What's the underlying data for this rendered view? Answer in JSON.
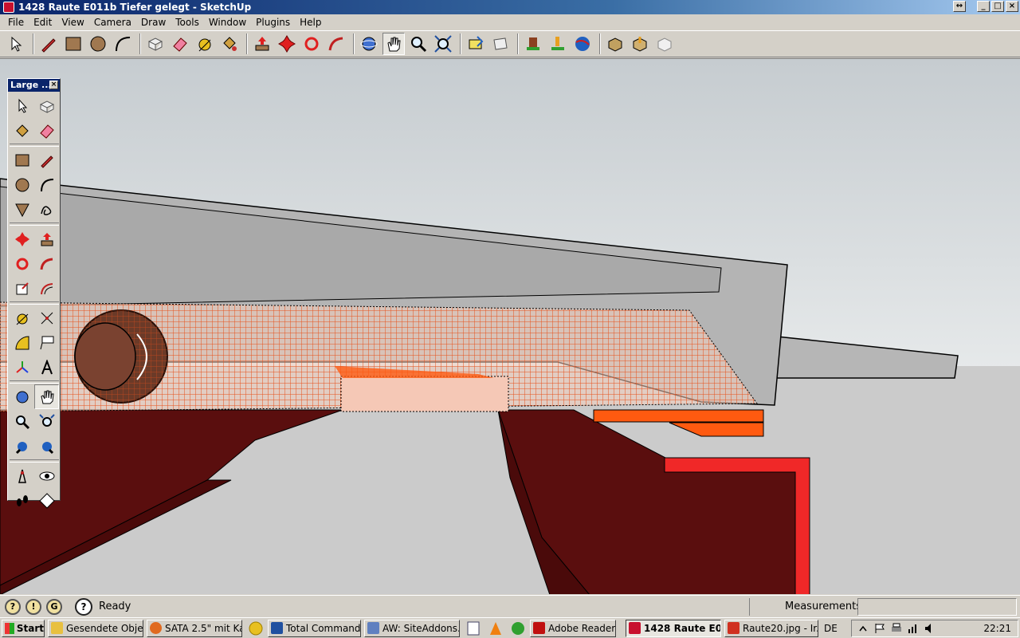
{
  "window": {
    "title": "1428 Raute E011b Tiefer gelegt - SketchUp",
    "buttons": {
      "restore_alt": "↔",
      "minimize": "_",
      "maximize": "□",
      "close": "×"
    }
  },
  "menu": [
    "File",
    "Edit",
    "View",
    "Camera",
    "Draw",
    "Tools",
    "Window",
    "Plugins",
    "Help"
  ],
  "toolbar": {
    "tools": [
      "select-icon",
      "pencil-icon",
      "rectangle-icon",
      "circle-icon",
      "arc-icon",
      "make-component-icon",
      "eraser-icon",
      "tape-measure-icon",
      "paint-bucket-icon",
      "push-pull-icon",
      "move-icon",
      "rotate-icon",
      "follow-me-icon",
      "orbit-icon",
      "pan-icon",
      "zoom-icon",
      "zoom-extents-icon",
      "previous-view-icon",
      "next-view-icon",
      "get-models-icon",
      "share-model-icon",
      "google-earth-icon",
      "get-components-icon",
      "share-component-icon",
      "warehouse-icon"
    ],
    "active": "pan-icon"
  },
  "palette": {
    "title": "Large ...",
    "close": "×",
    "active": "pan"
  },
  "status": {
    "ready": "Ready",
    "measurements_label": "Measurements",
    "measurements_value": ""
  },
  "taskbar": {
    "start": "Start",
    "tasks": [
      {
        "label": "Gesendete Obje...",
        "color": "#e8c040"
      },
      {
        "label": "SATA 2.5\" mit Ka...",
        "color": "#e06a20"
      },
      {
        "label": "Total Commande...",
        "color": "#2050a0"
      },
      {
        "label": "AW: SiteAddons....",
        "color": "#6080c0"
      },
      {
        "label": "Adobe Reader X",
        "color": "#c01010"
      },
      {
        "label": "1428 Raute E0...",
        "color": "#c8102e",
        "active": true
      },
      {
        "label": "Raute20.jpg - Ir...",
        "color": "#d03020"
      }
    ],
    "tray": {
      "lang": "DE",
      "time": "22:21"
    }
  },
  "colors": {
    "sky": "#d6dbdd",
    "ground": "#c9c9c9",
    "dark_red": "#5a0e0e",
    "orange": "#ff5a10",
    "red": "#f02828",
    "grey": "#b4b4b4"
  }
}
